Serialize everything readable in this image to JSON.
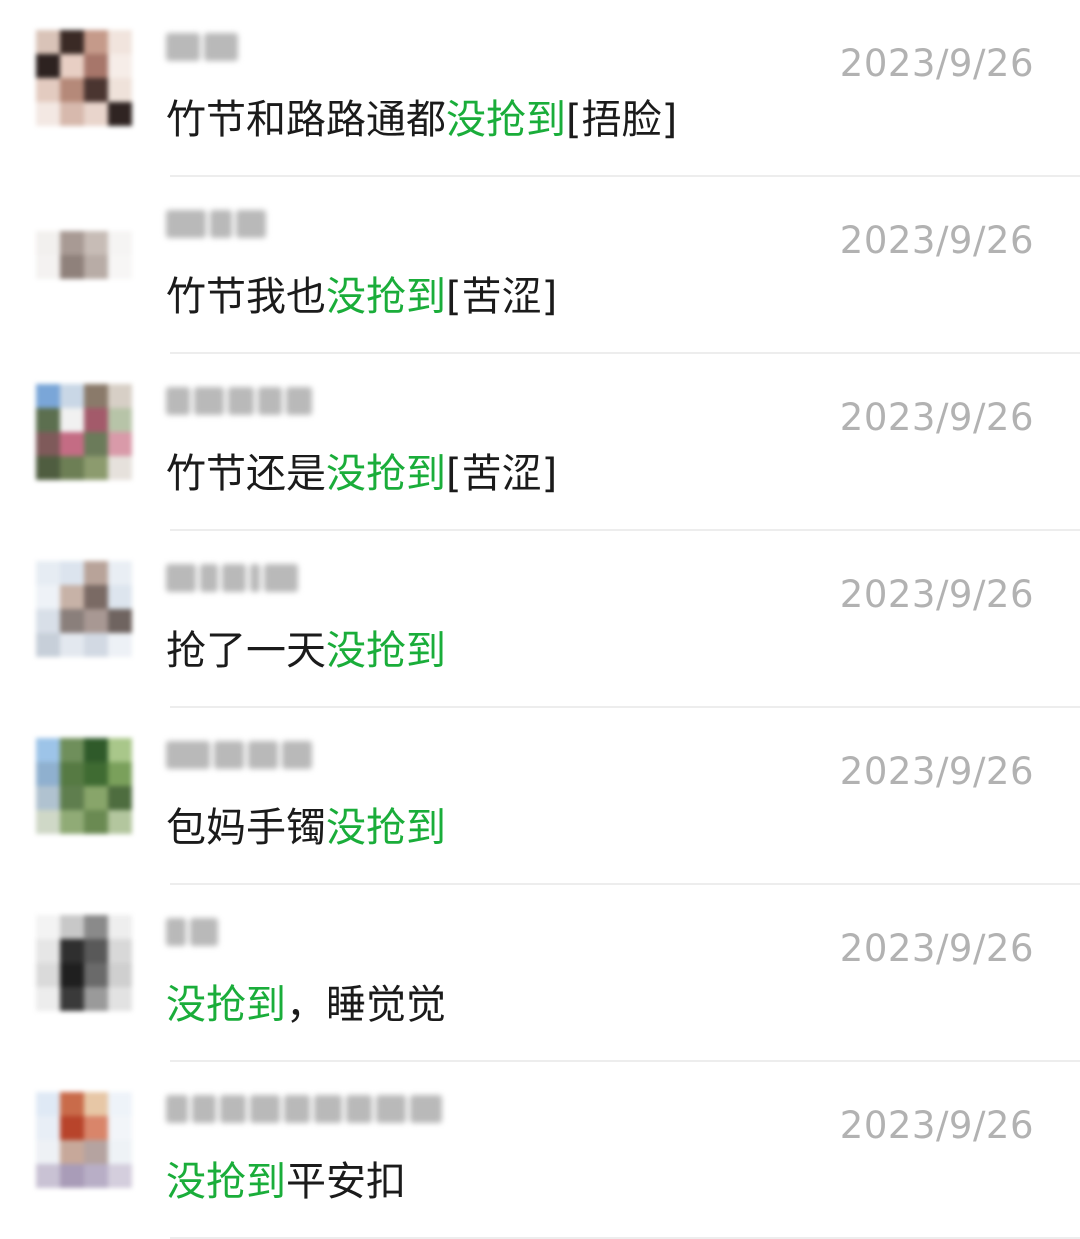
{
  "comments": [
    {
      "date": "2023/9/26",
      "message": [
        {
          "text": "竹节和路路通都",
          "highlight": false
        },
        {
          "text": "没抢到",
          "highlight": true
        },
        {
          "text": "[捂脸]",
          "highlight": false
        }
      ]
    },
    {
      "date": "2023/9/26",
      "message": [
        {
          "text": "竹节我也",
          "highlight": false
        },
        {
          "text": "没抢到",
          "highlight": true
        },
        {
          "text": "[苦涩]",
          "highlight": false
        }
      ]
    },
    {
      "date": "2023/9/26",
      "message": [
        {
          "text": "竹节还是",
          "highlight": false
        },
        {
          "text": "没抢到",
          "highlight": true
        },
        {
          "text": "[苦涩]",
          "highlight": false
        }
      ]
    },
    {
      "date": "2023/9/26",
      "message": [
        {
          "text": "抢了一天",
          "highlight": false
        },
        {
          "text": "没抢到",
          "highlight": true
        }
      ]
    },
    {
      "date": "2023/9/26",
      "message": [
        {
          "text": "包妈手镯",
          "highlight": false
        },
        {
          "text": "没抢到",
          "highlight": true
        }
      ]
    },
    {
      "date": "2023/9/26",
      "message": [
        {
          "text": "没抢到",
          "highlight": true
        },
        {
          "text": "，睡觉觉",
          "highlight": false
        }
      ]
    },
    {
      "date": "2023/9/26",
      "message": [
        {
          "text": "没抢到",
          "highlight": true
        },
        {
          "text": "平安扣",
          "highlight": false
        }
      ]
    }
  ],
  "colors": {
    "highlight": "#1aad3a",
    "text": "#1b1b1b",
    "date": "#b2b2b2",
    "divider": "#ededed"
  }
}
